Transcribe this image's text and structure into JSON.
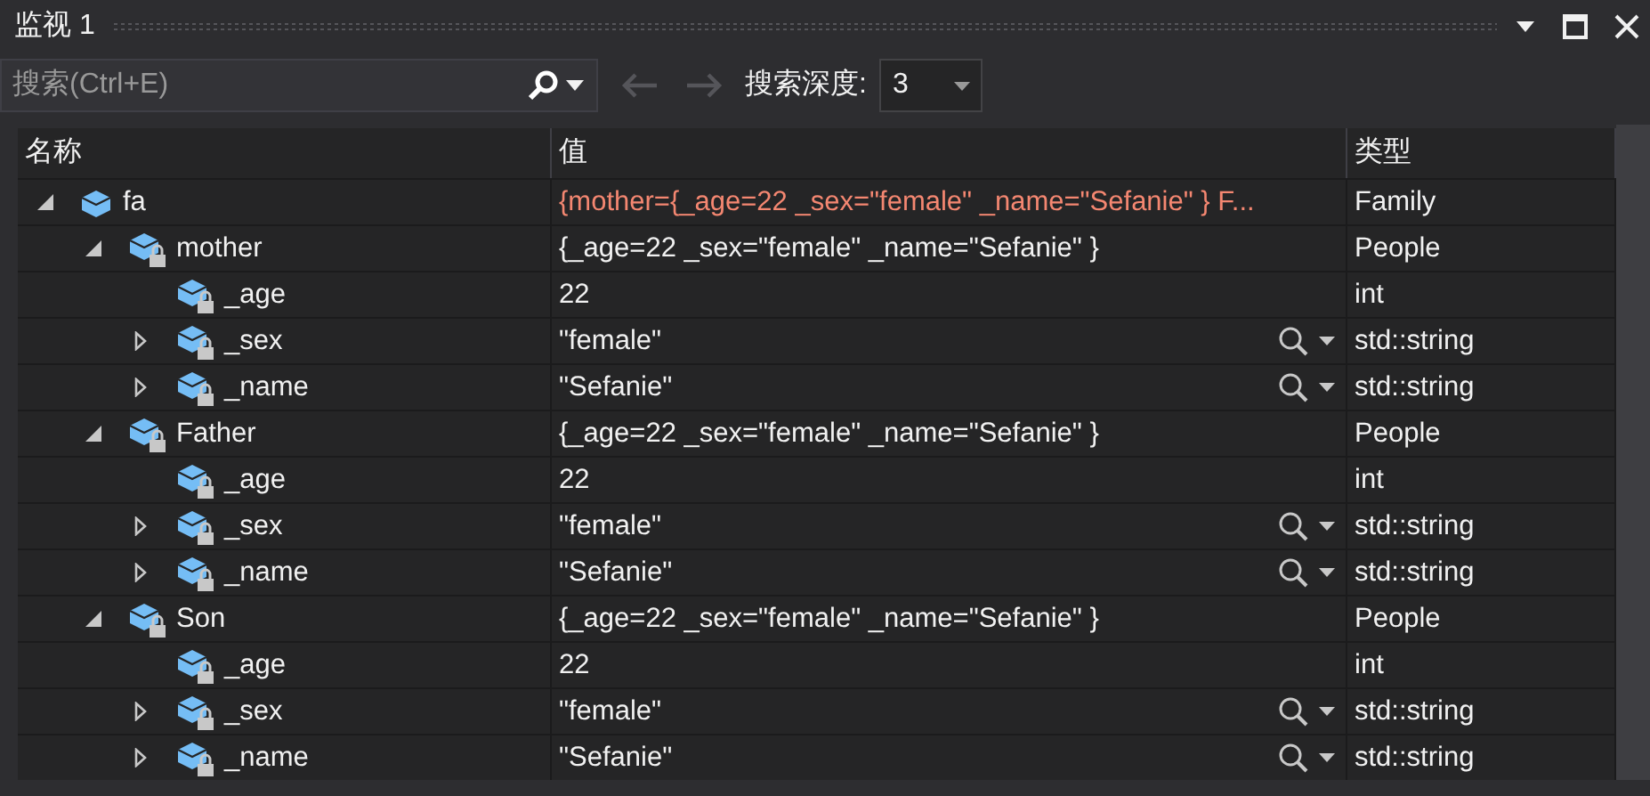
{
  "window": {
    "title": "监视 1"
  },
  "toolbar": {
    "search": {
      "placeholder": "搜索(Ctrl+E)"
    },
    "back_disabled": true,
    "forward_disabled": true,
    "depth_label": "搜索深度:",
    "depth_value": "3"
  },
  "table": {
    "columns": [
      "名称",
      "值",
      "类型"
    ],
    "rows": [
      {
        "name": "fa",
        "value": "{mother={_age=22 _sex=\"female\" _name=\"Sefanie\" } F...",
        "type": "Family",
        "has_children": true,
        "expanded": true,
        "private": false,
        "changed": true,
        "visualizer": false,
        "children": [
          {
            "name": "mother",
            "value": "{_age=22 _sex=\"female\" _name=\"Sefanie\" }",
            "type": "People",
            "has_children": true,
            "expanded": true,
            "private": true,
            "changed": false,
            "visualizer": false,
            "children": [
              {
                "name": "_age",
                "value": "22",
                "type": "int",
                "has_children": false,
                "private": true,
                "changed": false,
                "visualizer": false
              },
              {
                "name": "_sex",
                "value": "\"female\"",
                "type": "std::string",
                "has_children": true,
                "expanded": false,
                "private": true,
                "changed": false,
                "visualizer": true
              },
              {
                "name": "_name",
                "value": "\"Sefanie\"",
                "type": "std::string",
                "has_children": true,
                "expanded": false,
                "private": true,
                "changed": false,
                "visualizer": true
              }
            ]
          },
          {
            "name": "Father",
            "value": "{_age=22 _sex=\"female\" _name=\"Sefanie\" }",
            "type": "People",
            "has_children": true,
            "expanded": true,
            "private": true,
            "changed": false,
            "visualizer": false,
            "children": [
              {
                "name": "_age",
                "value": "22",
                "type": "int",
                "has_children": false,
                "private": true,
                "changed": false,
                "visualizer": false
              },
              {
                "name": "_sex",
                "value": "\"female\"",
                "type": "std::string",
                "has_children": true,
                "expanded": false,
                "private": true,
                "changed": false,
                "visualizer": true
              },
              {
                "name": "_name",
                "value": "\"Sefanie\"",
                "type": "std::string",
                "has_children": true,
                "expanded": false,
                "private": true,
                "changed": false,
                "visualizer": true
              }
            ]
          },
          {
            "name": "Son",
            "value": "{_age=22 _sex=\"female\" _name=\"Sefanie\" }",
            "type": "People",
            "has_children": true,
            "expanded": true,
            "private": true,
            "changed": false,
            "visualizer": false,
            "children": [
              {
                "name": "_age",
                "value": "22",
                "type": "int",
                "has_children": false,
                "private": true,
                "changed": false,
                "visualizer": false
              },
              {
                "name": "_sex",
                "value": "\"female\"",
                "type": "std::string",
                "has_children": true,
                "expanded": false,
                "private": true,
                "changed": false,
                "visualizer": true
              },
              {
                "name": "_name",
                "value": "\"Sefanie\"",
                "type": "std::string",
                "has_children": true,
                "expanded": false,
                "private": true,
                "changed": false,
                "visualizer": true
              }
            ]
          }
        ]
      }
    ]
  }
}
